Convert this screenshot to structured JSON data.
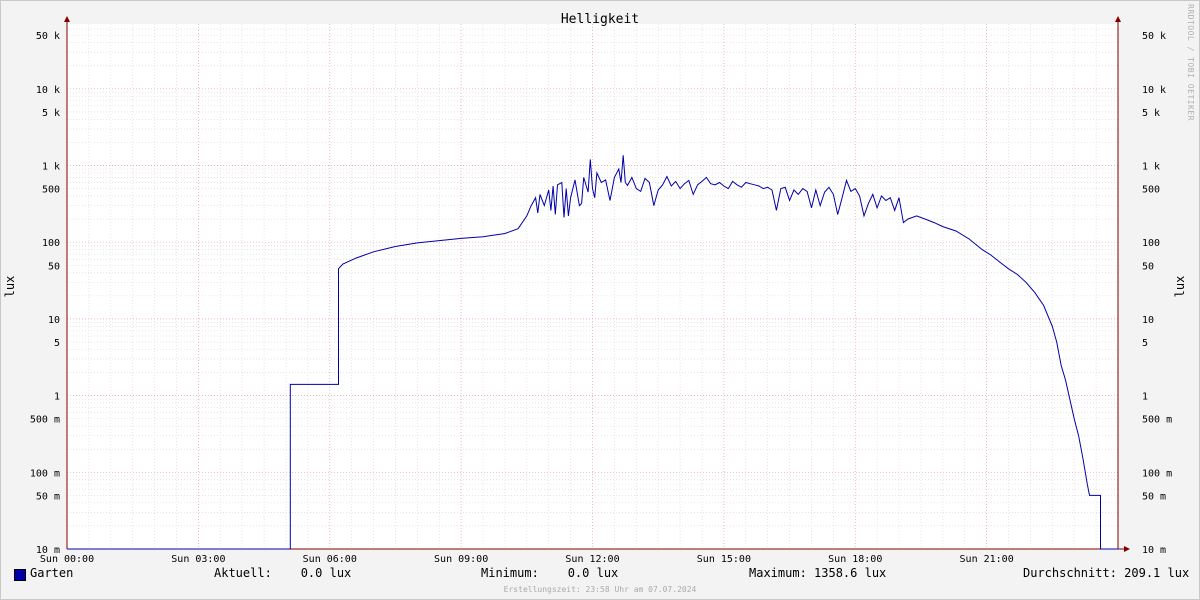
{
  "chart_data": {
    "type": "line",
    "title": "Helligkeit",
    "ylabel": "lux",
    "yscale": "log",
    "ylim": [
      0.01,
      70000
    ],
    "xlim": [
      0,
      24
    ],
    "grid": true,
    "legend_position": "bottom-left",
    "y_ticks": [
      {
        "value": 50000,
        "label": "50 k"
      },
      {
        "value": 10000,
        "label": "10 k"
      },
      {
        "value": 5000,
        "label": "5 k"
      },
      {
        "value": 1000,
        "label": "1 k"
      },
      {
        "value": 500,
        "label": "500"
      },
      {
        "value": 100,
        "label": "100"
      },
      {
        "value": 50,
        "label": "50"
      },
      {
        "value": 10,
        "label": "10"
      },
      {
        "value": 5,
        "label": "5"
      },
      {
        "value": 1,
        "label": "1"
      },
      {
        "value": 0.5,
        "label": "500 m"
      },
      {
        "value": 0.1,
        "label": "100 m"
      },
      {
        "value": 0.05,
        "label": "50 m"
      },
      {
        "value": 0.01,
        "label": "10 m"
      }
    ],
    "x_ticks": [
      {
        "value": 0,
        "label": "Sun 00:00"
      },
      {
        "value": 3,
        "label": "Sun 03:00"
      },
      {
        "value": 6,
        "label": "Sun 06:00"
      },
      {
        "value": 9,
        "label": "Sun 09:00"
      },
      {
        "value": 12,
        "label": "Sun 12:00"
      },
      {
        "value": 15,
        "label": "Sun 15:00"
      },
      {
        "value": 18,
        "label": "Sun 18:00"
      },
      {
        "value": 21,
        "label": "Sun 21:00"
      }
    ],
    "series": [
      {
        "name": "Garten",
        "color": "#0000aa",
        "points": [
          [
            0,
            0.01
          ],
          [
            5.1,
            0.01
          ],
          [
            5.1,
            1.4
          ],
          [
            6.2,
            1.4
          ],
          [
            6.2,
            45
          ],
          [
            6.3,
            52
          ],
          [
            6.6,
            62
          ],
          [
            7,
            75
          ],
          [
            7.5,
            88
          ],
          [
            8,
            98
          ],
          [
            8.5,
            105
          ],
          [
            9,
            112
          ],
          [
            9.5,
            118
          ],
          [
            10,
            130
          ],
          [
            10.3,
            150
          ],
          [
            10.5,
            220
          ],
          [
            10.6,
            300
          ],
          [
            10.7,
            380
          ],
          [
            10.75,
            240
          ],
          [
            10.8,
            420
          ],
          [
            10.9,
            300
          ],
          [
            11,
            480
          ],
          [
            11.05,
            260
          ],
          [
            11.1,
            540
          ],
          [
            11.15,
            230
          ],
          [
            11.2,
            560
          ],
          [
            11.3,
            600
          ],
          [
            11.35,
            210
          ],
          [
            11.4,
            500
          ],
          [
            11.45,
            220
          ],
          [
            11.5,
            380
          ],
          [
            11.6,
            650
          ],
          [
            11.7,
            300
          ],
          [
            11.75,
            320
          ],
          [
            11.8,
            700
          ],
          [
            11.9,
            450
          ],
          [
            11.95,
            1200
          ],
          [
            12,
            500
          ],
          [
            12.05,
            380
          ],
          [
            12.1,
            800
          ],
          [
            12.2,
            600
          ],
          [
            12.3,
            650
          ],
          [
            12.4,
            350
          ],
          [
            12.5,
            700
          ],
          [
            12.6,
            900
          ],
          [
            12.65,
            600
          ],
          [
            12.7,
            1358.6
          ],
          [
            12.75,
            600
          ],
          [
            12.8,
            550
          ],
          [
            12.9,
            700
          ],
          [
            13,
            500
          ],
          [
            13.1,
            460
          ],
          [
            13.2,
            680
          ],
          [
            13.3,
            600
          ],
          [
            13.4,
            300
          ],
          [
            13.5,
            480
          ],
          [
            13.6,
            560
          ],
          [
            13.7,
            720
          ],
          [
            13.8,
            540
          ],
          [
            13.9,
            620
          ],
          [
            14,
            500
          ],
          [
            14.1,
            580
          ],
          [
            14.2,
            640
          ],
          [
            14.3,
            420
          ],
          [
            14.4,
            560
          ],
          [
            14.5,
            620
          ],
          [
            14.6,
            700
          ],
          [
            14.7,
            580
          ],
          [
            14.8,
            560
          ],
          [
            14.9,
            600
          ],
          [
            15,
            540
          ],
          [
            15.1,
            500
          ],
          [
            15.2,
            620
          ],
          [
            15.3,
            560
          ],
          [
            15.4,
            520
          ],
          [
            15.5,
            600
          ],
          [
            15.6,
            580
          ],
          [
            15.7,
            560
          ],
          [
            15.8,
            540
          ],
          [
            15.9,
            500
          ],
          [
            16,
            520
          ],
          [
            16.1,
            480
          ],
          [
            16.2,
            260
          ],
          [
            16.3,
            500
          ],
          [
            16.4,
            520
          ],
          [
            16.5,
            350
          ],
          [
            16.6,
            480
          ],
          [
            16.7,
            420
          ],
          [
            16.8,
            500
          ],
          [
            16.9,
            460
          ],
          [
            17,
            280
          ],
          [
            17.1,
            480
          ],
          [
            17.2,
            300
          ],
          [
            17.3,
            450
          ],
          [
            17.4,
            520
          ],
          [
            17.5,
            420
          ],
          [
            17.6,
            230
          ],
          [
            17.7,
            380
          ],
          [
            17.8,
            640
          ],
          [
            17.9,
            460
          ],
          [
            18,
            500
          ],
          [
            18.1,
            400
          ],
          [
            18.2,
            220
          ],
          [
            18.3,
            320
          ],
          [
            18.4,
            420
          ],
          [
            18.5,
            280
          ],
          [
            18.6,
            400
          ],
          [
            18.7,
            350
          ],
          [
            18.8,
            380
          ],
          [
            18.9,
            260
          ],
          [
            19,
            380
          ],
          [
            19.1,
            180
          ],
          [
            19.2,
            200
          ],
          [
            19.4,
            220
          ],
          [
            19.6,
            200
          ],
          [
            19.8,
            180
          ],
          [
            20,
            160
          ],
          [
            20.3,
            140
          ],
          [
            20.6,
            110
          ],
          [
            20.9,
            80
          ],
          [
            21.1,
            68
          ],
          [
            21.3,
            55
          ],
          [
            21.5,
            45
          ],
          [
            21.7,
            38
          ],
          [
            21.9,
            30
          ],
          [
            22.1,
            22
          ],
          [
            22.3,
            15
          ],
          [
            22.5,
            8
          ],
          [
            22.6,
            5
          ],
          [
            22.7,
            2.5
          ],
          [
            22.8,
            1.6
          ],
          [
            22.9,
            0.9
          ],
          [
            23,
            0.5
          ],
          [
            23.1,
            0.3
          ],
          [
            23.2,
            0.15
          ],
          [
            23.3,
            0.07
          ],
          [
            23.35,
            0.05
          ],
          [
            23.6,
            0.05
          ],
          [
            23.6,
            0.01
          ],
          [
            24,
            0.01
          ]
        ]
      }
    ]
  },
  "legend": {
    "series_label": "Garten",
    "aktuell": "Aktuell:    0.0 lux",
    "minimum": "Minimum:    0.0 lux",
    "maximum": "Maximum: 1358.6 lux",
    "durchschnitt": "Durchschnitt: 209.1 lux"
  },
  "footer": "Erstellungszeit: 23:58 Uhr am 07.07.2024",
  "watermark": "RRDTOOL / TOBI OETIKER",
  "colors": {
    "series": "#0000aa",
    "background": "#f3f3f3",
    "plot": "#ffffff",
    "axis": "#800000"
  }
}
